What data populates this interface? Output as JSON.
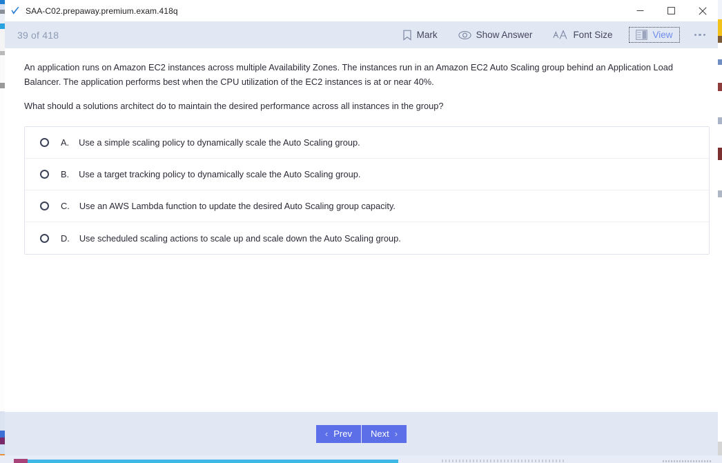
{
  "window": {
    "title": "SAA-C02.prepaway.premium.exam.418q",
    "app_icon": "blue-check-icon",
    "controls": {
      "minimize": "–",
      "maximize": "☐",
      "close": "✕",
      "minimize_name": "minimize-button",
      "maximize_name": "maximize-button",
      "close_name": "close-button"
    }
  },
  "toolbar": {
    "counter": "39 of 418",
    "counter_color": "#8d9bb5",
    "background": "#e2e8f3",
    "items": [
      {
        "label": "Mark",
        "icon": "bookmark-icon"
      },
      {
        "label": "Show Answer",
        "icon": "eye-icon"
      },
      {
        "label": "Font Size",
        "icon": "font-size-icon"
      },
      {
        "label": "View",
        "icon": "layout-panel-icon",
        "focused": true,
        "label_color": "#6d8cf0"
      }
    ],
    "more_label": "more-options-icon"
  },
  "question": {
    "stem": "An application runs on Amazon EC2 instances across multiple Availability Zones. The instances run in an Amazon EC2 Auto Scaling group behind an Application Load Balancer. The application performs best when the CPU utilization of the EC2 instances is at or near 40%.",
    "prompt": "What should a solutions architect do to maintain the desired performance across all instances in the group?",
    "options": [
      {
        "letter": "A.",
        "text": "Use a simple scaling policy to dynamically scale the Auto Scaling group.",
        "selected": false
      },
      {
        "letter": "B.",
        "text": "Use a target tracking policy to dynamically scale the Auto Scaling group.",
        "selected": false
      },
      {
        "letter": "C.",
        "text": "Use an AWS Lambda function to update the desired Auto Scaling group capacity.",
        "selected": false
      },
      {
        "letter": "D.",
        "text": "Use scheduled scaling actions to scale up and scale down the Auto Scaling group.",
        "selected": false
      }
    ]
  },
  "footer": {
    "prev_label": "Prev",
    "next_label": "Next",
    "prev_chevron": "‹",
    "next_chevron": "›",
    "button_color": "#5c6fe8",
    "background": "#e2e8f3"
  }
}
